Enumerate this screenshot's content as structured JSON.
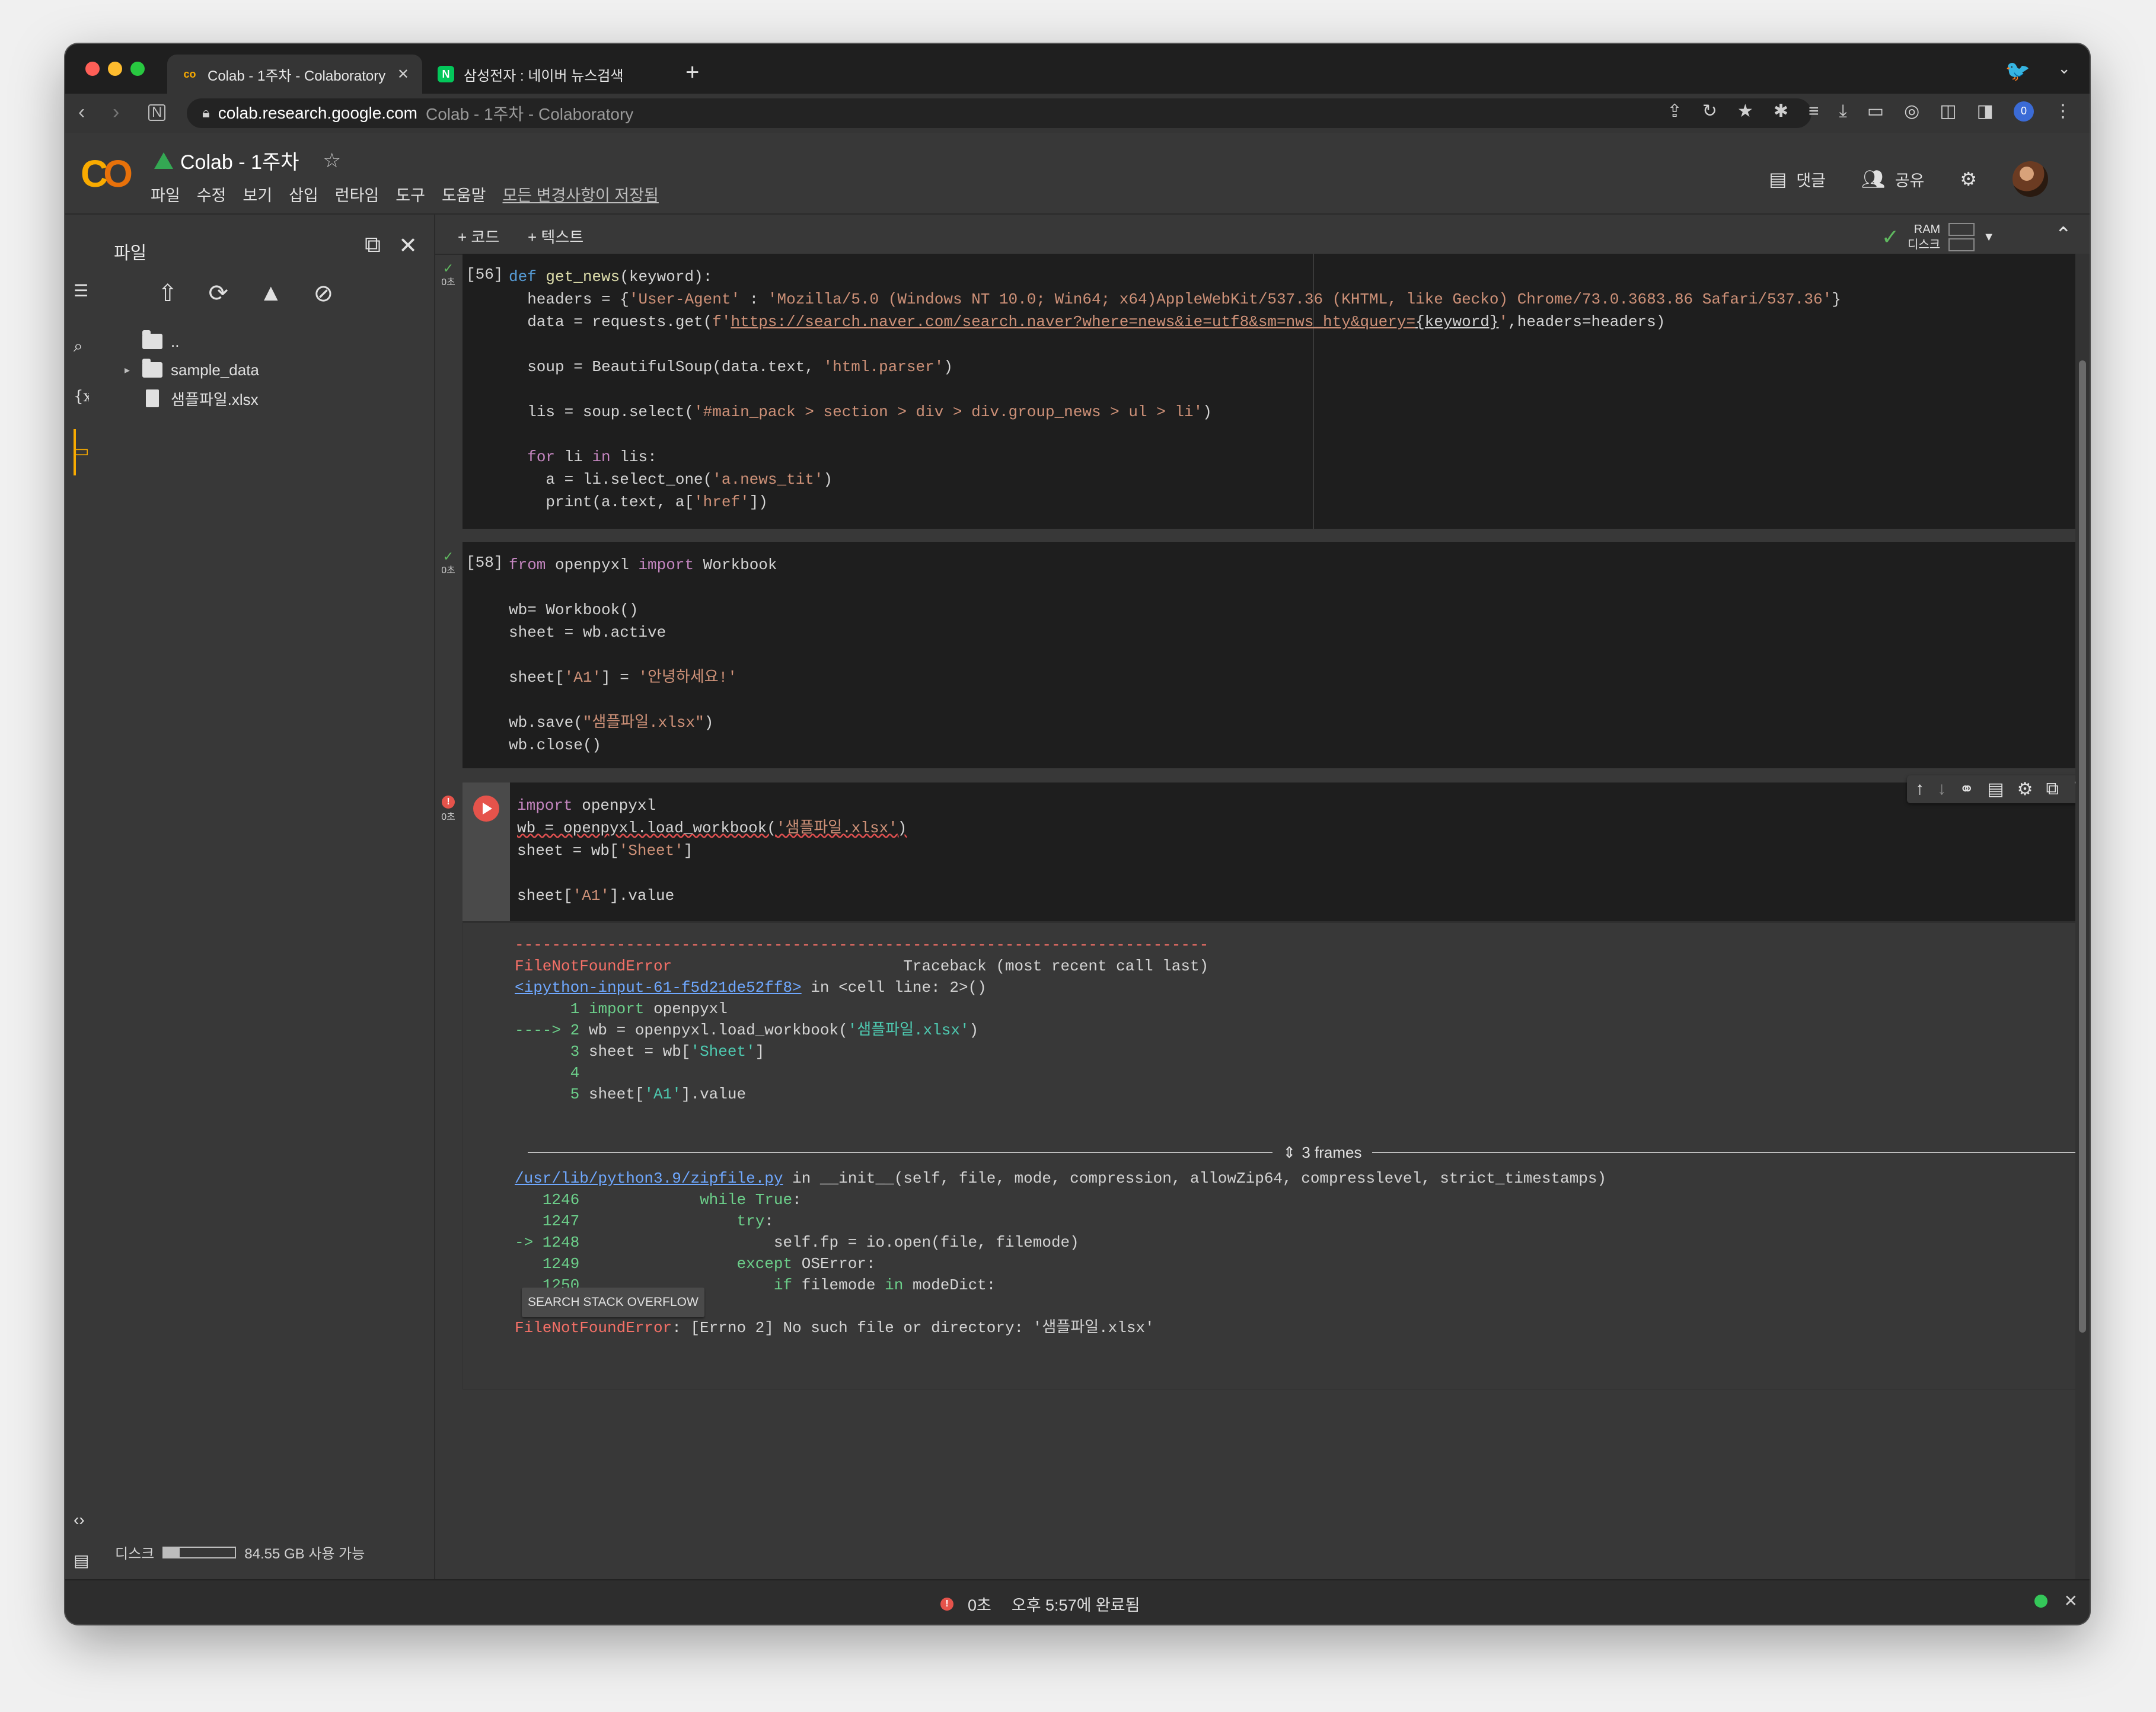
{
  "browser": {
    "tabs": [
      {
        "title": "Colab - 1주차 - Colaboratory",
        "active": true,
        "icon": "colab-icon"
      },
      {
        "title": "삼성전자 : 네이버 뉴스검색",
        "active": false,
        "icon": "naver-icon"
      }
    ],
    "new_tab": "+",
    "address": {
      "host": "colab.research.google.com",
      "rest": "Colab - 1주차 - Colaboratory"
    },
    "profile_badge": "0"
  },
  "colab": {
    "logo": "CO",
    "notebook_title": "Colab - 1주차",
    "menu": [
      "파일",
      "수정",
      "보기",
      "삽입",
      "런타임",
      "도구",
      "도움말"
    ],
    "save_status": "모든 변경사항이 저장됨",
    "comment_label": "댓글",
    "share_label": "공유"
  },
  "sidebar": {
    "title": "파일",
    "tree": [
      {
        "name": "..",
        "type": "folder-up"
      },
      {
        "name": "sample_data",
        "type": "folder"
      },
      {
        "name": "샘플파일.xlsx",
        "type": "file"
      }
    ],
    "disk_label": "디스크",
    "disk_free": "84.55 GB 사용 가능",
    "disk_used_fraction": 0.22
  },
  "toolbar": {
    "add_code": "+ 코드",
    "add_text": "+ 텍스트",
    "ram_label": "RAM",
    "disk_label": "디스크"
  },
  "cells": {
    "cell1": {
      "exec": "[56]",
      "time": "0초"
    },
    "cell2": {
      "exec": "[58]",
      "time": "0초"
    },
    "cell3": {
      "time": "0초"
    }
  },
  "output": {
    "frames_label": "3 frames",
    "so_button": "SEARCH STACK OVERFLOW"
  },
  "status": {
    "time": "0초",
    "completed": "오후 5:57에 완료됨"
  }
}
